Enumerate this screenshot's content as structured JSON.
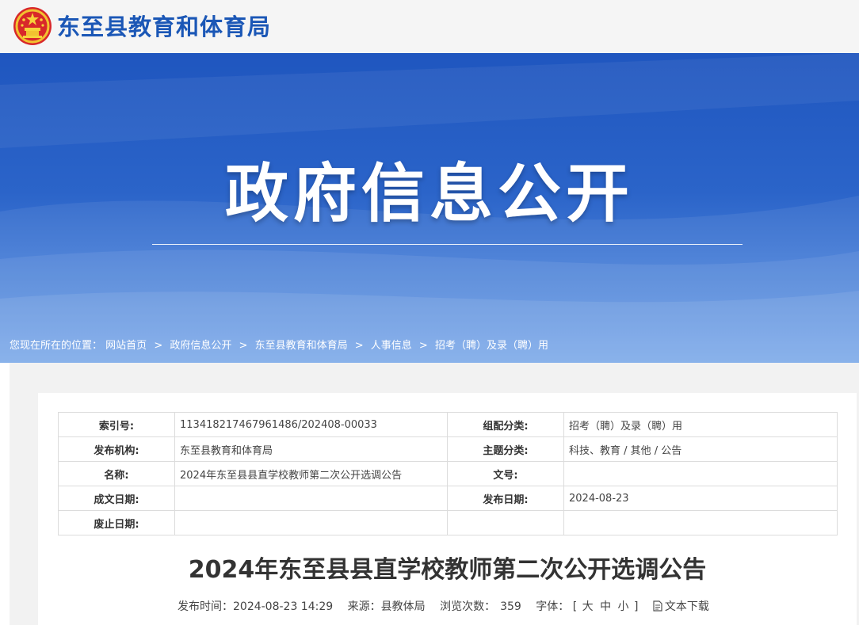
{
  "header": {
    "site_name": "东至县教育和体育局"
  },
  "banner": {
    "title": "政府信息公开"
  },
  "breadcrumb": {
    "prefix": "您现在所在的位置：",
    "items": [
      "网站首页",
      "政府信息公开",
      "东至县教育和体育局",
      "人事信息",
      "招考（聘）及录（聘）用"
    ],
    "separator": ">"
  },
  "meta": {
    "rows": [
      {
        "l1": "索引号:",
        "v1": "113418217467961486/202408-00033",
        "l2": "组配分类:",
        "v2": "招考（聘）及录（聘）用"
      },
      {
        "l1": "发布机构:",
        "v1": "东至县教育和体育局",
        "l2": "主题分类:",
        "v2": "科技、教育 / 其他 / 公告"
      },
      {
        "l1": "名称:",
        "v1": "2024年东至县县直学校教师第二次公开选调公告",
        "l2": "文号:",
        "v2": ""
      },
      {
        "l1": "成文日期:",
        "v1": "",
        "l2": "发布日期:",
        "v2": "2024-08-23"
      },
      {
        "l1": "废止日期:",
        "v1": "",
        "l2": "",
        "v2": ""
      }
    ]
  },
  "article": {
    "title": "2024年东至县县直学校教师第二次公开选调公告",
    "publish_label": "发布时间：",
    "publish_time": "2024-08-23 14:29",
    "source_label": "来源：",
    "source": "县教体局",
    "views_label": "浏览次数：",
    "views": "359",
    "font_label": "字体：",
    "font_open": "[",
    "font_large": "大",
    "font_medium": "中",
    "font_small": "小",
    "font_close": "]",
    "download_label": "文本下载",
    "download_icon": "document-icon"
  },
  "colors": {
    "brand_blue": "#1b57b6",
    "banner_blue": "#1f56bf"
  }
}
